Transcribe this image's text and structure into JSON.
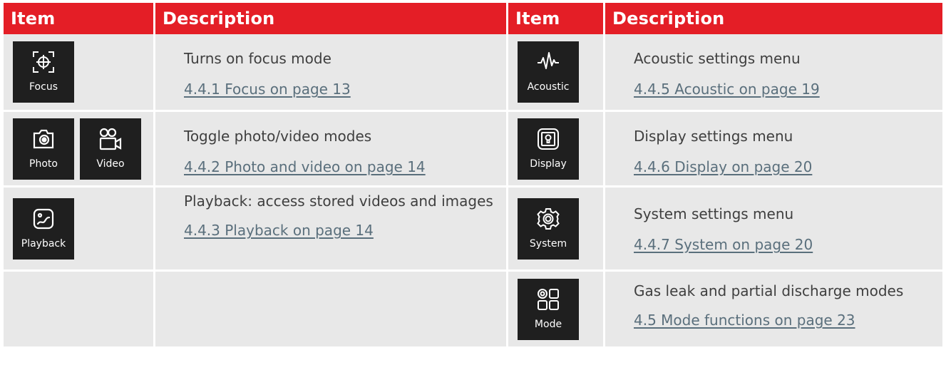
{
  "header": {
    "col1": "Item",
    "col2": "Description",
    "col3": "Item",
    "col4": "Description"
  },
  "left": [
    {
      "icons": [
        {
          "label": "Focus",
          "icon": "focus-icon"
        }
      ],
      "text": "Turns on focus mode",
      "link": "4.4.1 Focus on page 13"
    },
    {
      "icons": [
        {
          "label": "Photo",
          "icon": "camera-icon"
        },
        {
          "label": "Video",
          "icon": "video-camera-icon"
        }
      ],
      "text": "Toggle photo/video modes",
      "link": "4.4.2 Photo and video on page 14"
    },
    {
      "icons": [
        {
          "label": "Playback",
          "icon": "playback-icon"
        }
      ],
      "text": "Playback: access stored videos and images",
      "link": "4.4.3 Playback on page 14"
    }
  ],
  "right": [
    {
      "icons": [
        {
          "label": "Acoustic",
          "icon": "waveform-icon"
        }
      ],
      "text": "Acoustic settings menu",
      "link": "4.4.5 Acoustic on page 19"
    },
    {
      "icons": [
        {
          "label": "Display",
          "icon": "display-icon"
        }
      ],
      "text": "Display settings menu",
      "link": "4.4.6 Display on page 20"
    },
    {
      "icons": [
        {
          "label": "System",
          "icon": "gear-icon"
        }
      ],
      "text": "System settings menu",
      "link": "4.4.7 System on page 20"
    },
    {
      "icons": [
        {
          "label": "Mode",
          "icon": "mode-grid-icon"
        }
      ],
      "text": "Gas leak and partial discharge modes",
      "link": "4.5 Mode functions on page 23"
    }
  ],
  "colors": {
    "header_bg": "#e41e26",
    "cell_bg": "#e8e8e8",
    "tile_bg": "#1f1f1f",
    "link": "#5a6f7c",
    "text": "#3f3f3f"
  }
}
